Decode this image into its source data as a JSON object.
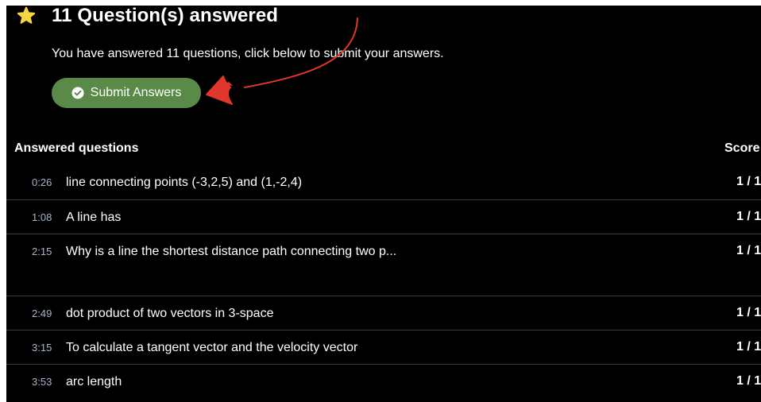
{
  "header": {
    "title": "11 Question(s) answered",
    "icon": "star-icon",
    "icon_color": "#f5d63d"
  },
  "description": "You have answered 11 questions, click below to submit your answers.",
  "submit_button": {
    "label": "Submit Answers",
    "icon": "check-circle-icon",
    "color": "#5a8a47"
  },
  "annotation": {
    "type": "red-arrow",
    "color": "#e0362b"
  },
  "answered": {
    "heading": "Answered questions",
    "score_heading": "Score",
    "rows": [
      {
        "time": "0:26",
        "question": "line connecting points (-3,2,5) and (1,-2,4)",
        "score": "1 / 1"
      },
      {
        "time": "1:08",
        "question": "A line has",
        "score": "1 / 1"
      },
      {
        "time": "2:15",
        "question": "Why is a line the shortest distance path connecting two p...",
        "score": "1 / 1"
      },
      {
        "time": "2:49",
        "question": "dot product of two vectors in 3-space",
        "score": "1 / 1"
      },
      {
        "time": "3:15",
        "question": "To calculate a tangent vector and the velocity vector",
        "score": "1 / 1"
      },
      {
        "time": "3:53",
        "question": "arc length",
        "score": "1 / 1"
      }
    ]
  }
}
